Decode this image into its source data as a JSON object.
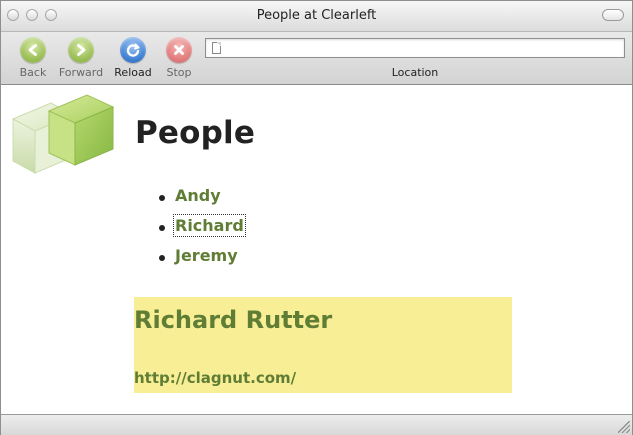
{
  "window": {
    "title": "People at Clearleft"
  },
  "toolbar": {
    "back_label": "Back",
    "forward_label": "Forward",
    "reload_label": "Reload",
    "stop_label": "Stop",
    "location_label": "Location",
    "location_value": ""
  },
  "page": {
    "heading": "People",
    "people": [
      {
        "name": "Andy"
      },
      {
        "name": "Richard"
      },
      {
        "name": "Jeremy"
      }
    ],
    "selected_person": {
      "name": "Richard Rutter",
      "url": "http://clagnut.com/"
    }
  },
  "icons": {
    "back": "left-arrow-icon",
    "forward": "right-arrow-icon",
    "reload": "reload-icon",
    "stop": "stop-icon",
    "page": "page-icon",
    "logo": "cube-logo"
  },
  "colors": {
    "accent_green": "#5f7d34",
    "highlight_yellow": "#f8ee95",
    "reload_blue": "#3d7fd2",
    "stop_red": "#e37f7f"
  }
}
